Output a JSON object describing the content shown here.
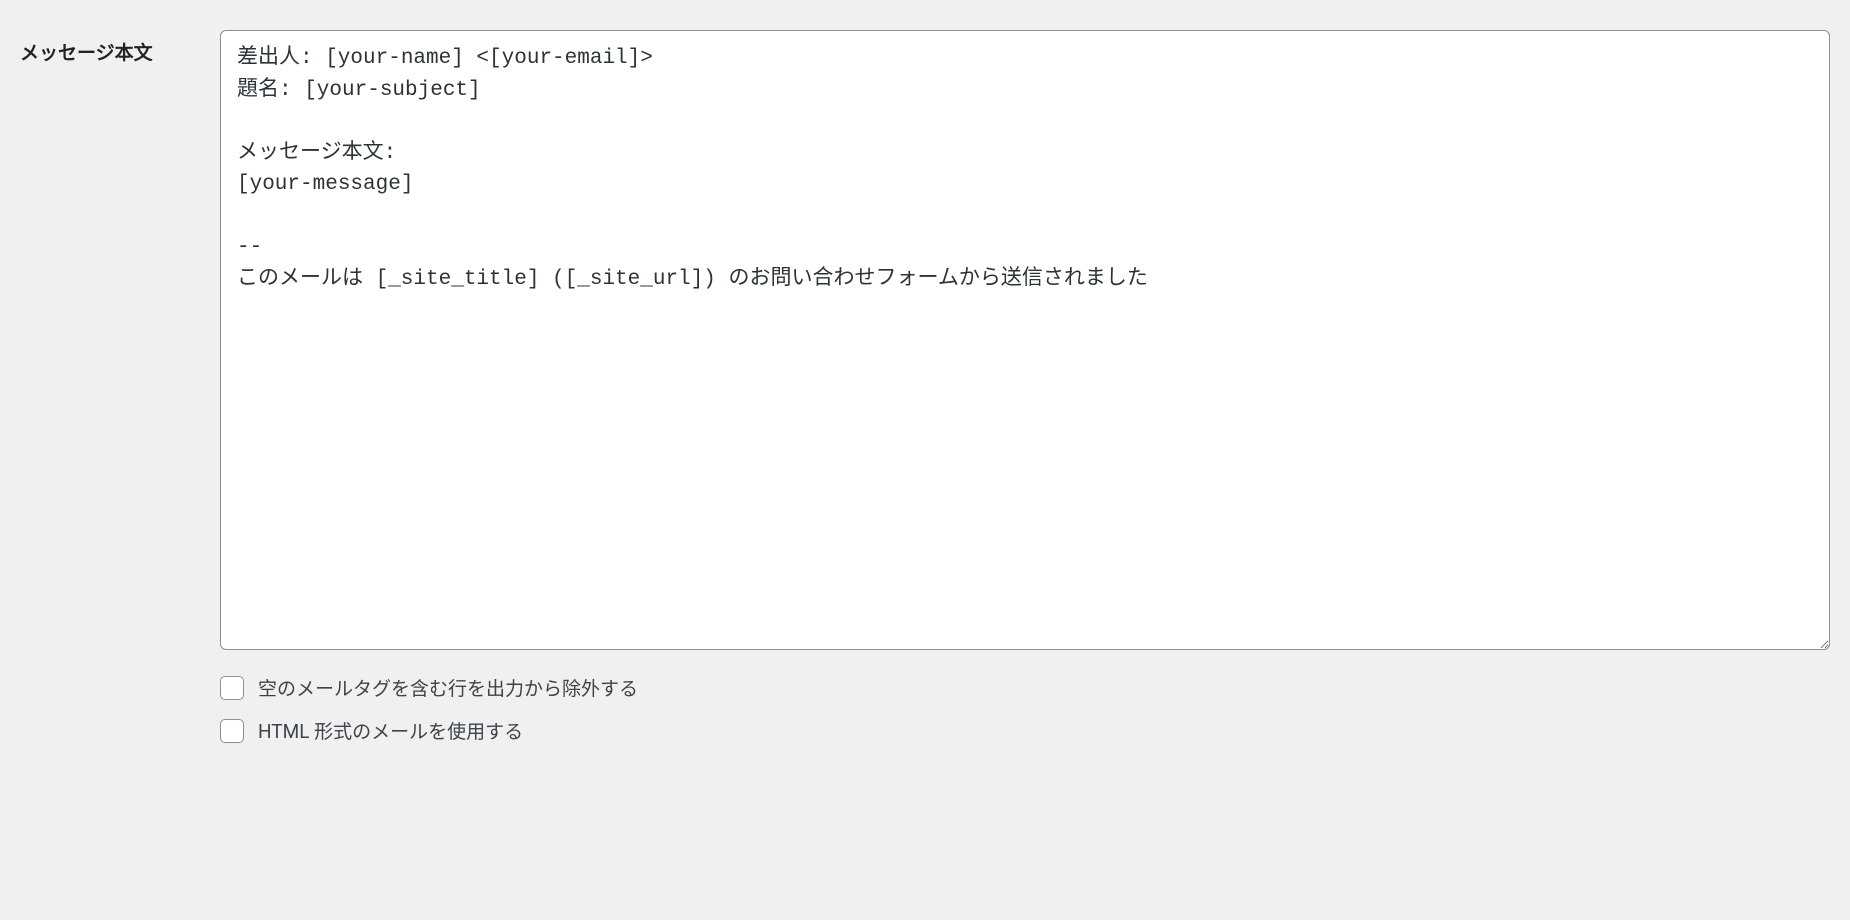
{
  "form": {
    "message_body_label": "メッセージ本文",
    "message_body_value": "差出人: [your-name] <[your-email]>\n題名: [your-subject]\n\nメッセージ本文:\n[your-message]\n\n-- \nこのメールは [_site_title] ([_site_url]) のお問い合わせフォームから送信されました",
    "checkboxes": {
      "exclude_blank_label": "空のメールタグを含む行を出力から除外する",
      "use_html_label": "HTML 形式のメールを使用する"
    }
  }
}
